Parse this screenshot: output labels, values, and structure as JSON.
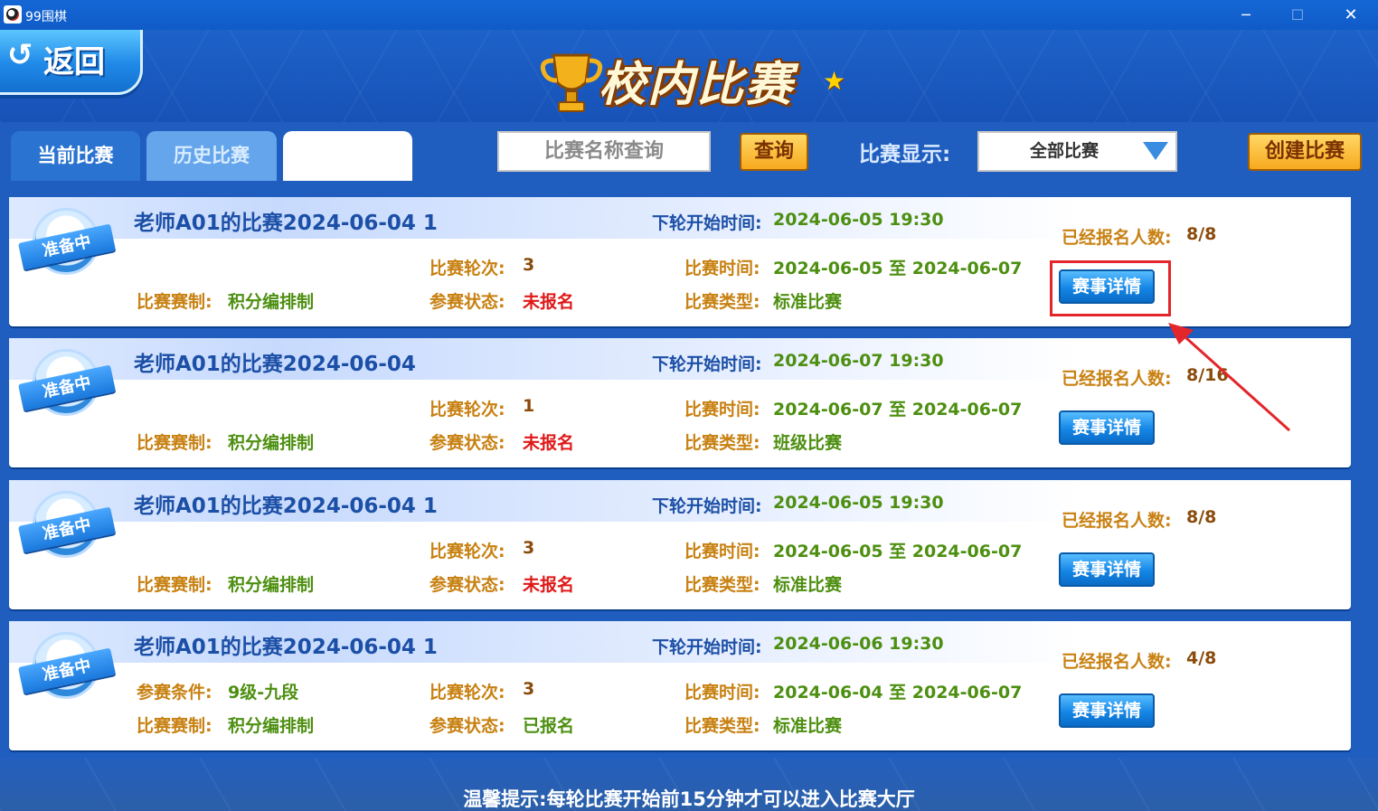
{
  "window": {
    "title": "99围棋",
    "buttons": {
      "minimize": "─",
      "maximize": "☐",
      "close": "✕"
    }
  },
  "header": {
    "back_label": "返回",
    "back_icon": "undo-arrow-icon",
    "title": "校内比赛"
  },
  "toolbar": {
    "tabs": [
      "当前比赛",
      "历史比赛",
      ""
    ],
    "search_placeholder": "比赛名称查询",
    "search_button": "查询",
    "filter_label": "比赛显示:",
    "filter_value": "全部比赛",
    "create_button": "创建比赛"
  },
  "labels": {
    "next_round": "下轮开始时间:",
    "registered": "已经报名人数:",
    "condition": "参赛条件:",
    "rounds": "比赛轮次:",
    "time": "比赛时间:",
    "system": "比赛赛制:",
    "status": "参赛状态:",
    "type": "比赛类型:",
    "badge": "准备中",
    "detail_button": "赛事详情"
  },
  "matches": [
    {
      "title": "老师A01的比赛2024-06-04 1",
      "next_round": "2024-06-05 19:30",
      "registered": "8/8",
      "condition": "",
      "rounds": "3",
      "time": "2024-06-05 至 2024-06-07",
      "system": "积分编排制",
      "status": "未报名",
      "type": "标准比赛"
    },
    {
      "title": "老师A01的比赛2024-06-04",
      "next_round": "2024-06-07 19:30",
      "registered": "8/16",
      "condition": "",
      "rounds": "1",
      "time": "2024-06-07 至 2024-06-07",
      "system": "积分编排制",
      "status": "未报名",
      "type": "班级比赛"
    },
    {
      "title": "老师A01的比赛2024-06-04 1",
      "next_round": "2024-06-05 19:30",
      "registered": "8/8",
      "condition": "",
      "rounds": "3",
      "time": "2024-06-05 至 2024-06-07",
      "system": "积分编排制",
      "status": "未报名",
      "type": "标准比赛"
    },
    {
      "title": "老师A01的比赛2024-06-04 1",
      "next_round": "2024-06-06 19:30",
      "registered": "4/8",
      "condition": "9级-九段",
      "rounds": "3",
      "time": "2024-06-04 至 2024-06-07",
      "system": "积分编排制",
      "status": "已报名",
      "type": "标准比赛"
    }
  ],
  "footer": {
    "tip": "温馨提示:每轮比赛开始前15分钟才可以进入比赛大厅"
  },
  "colors": {
    "accent": "#1f5dbf",
    "highlight": "#e4252b",
    "label": "#c88112",
    "value": "#4d8f10",
    "unregistered": "#e01818"
  }
}
